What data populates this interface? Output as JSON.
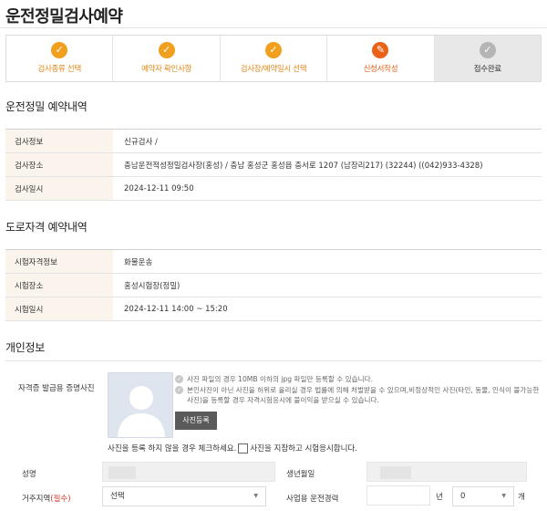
{
  "page": {
    "title": "운전정밀검사예약"
  },
  "stepper": {
    "steps": [
      {
        "label": "검사종류 선택",
        "state": "done"
      },
      {
        "label": "예약자 확인사항",
        "state": "done"
      },
      {
        "label": "검사장/예약일시 선택",
        "state": "done"
      },
      {
        "label": "신청서작성",
        "state": "active"
      },
      {
        "label": "접수완료",
        "state": "pending"
      }
    ]
  },
  "precision_exam": {
    "section_title": "운전정밀 예약내역",
    "rows": [
      {
        "label": "검사정보",
        "value": "신규검사 /"
      },
      {
        "label": "검사장소",
        "value": "충남운전적성정밀검사장(홍성) / 충남 홍성군 홍성읍 충서로 1207 (남장리217) (32244) ((042)933-4328)"
      },
      {
        "label": "검사일시",
        "value": "2024-12-11 09:50"
      }
    ]
  },
  "road_qualification": {
    "section_title": "도로자격 예약내역",
    "rows": [
      {
        "label": "시험자격정보",
        "value": "화물운송"
      },
      {
        "label": "시험장소",
        "value": "홍성시험장(정밀)"
      },
      {
        "label": "시험일시",
        "value": "2024-12-11 14:00 ~ 15:20"
      }
    ]
  },
  "personal": {
    "section_title": "개인정보",
    "photo_label": "자격증 발급용 증명사진",
    "notes": [
      "사진 파일의 경우 10MB 이하의 jpg 파일만 등록할 수 있습니다.",
      "본인사진이 아닌 사진을 허위로 올리실 경우 법률에 의해 처벌받을 수 있으며,비정상적인 사진(타인, 동물, 인식이 불가능한 사진)을 등록할 경우 자격시험응시에 불이익을 받으실 수 있습니다."
    ],
    "photo_button": "사진등록",
    "skip_prefix": "사진을 등록 하지 않을 경우 체크하세요.",
    "skip_suffix": "사진을 지참하고 시험응시합니다.",
    "name_label": "성명",
    "birth_label": "생년월일",
    "region_label": "거주지역",
    "region_required": "(필수)",
    "region_value": "선택",
    "career_label": "사업용 운전경력",
    "career_year_unit": "년",
    "career_month_value": "0",
    "career_month_unit": "개"
  }
}
